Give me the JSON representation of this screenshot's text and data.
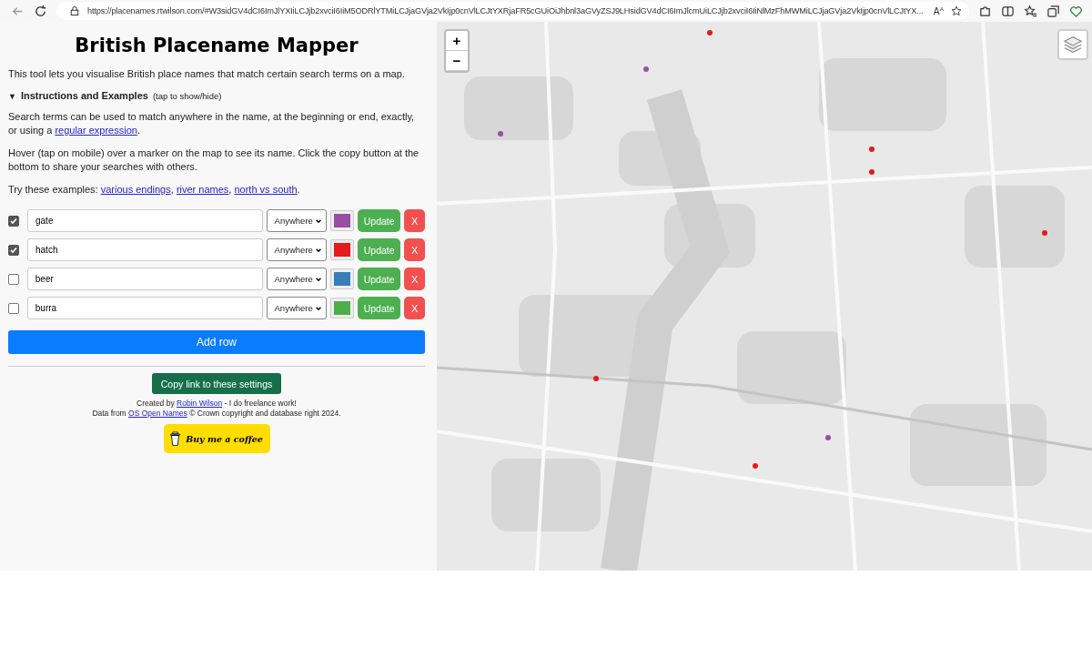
{
  "browser": {
    "url": "https://placenames.rtwilson.com/#W3sidGV4dCI6ImJlYXIiLCJjb2xvciI6IiM5ODRlYTMiLCJjaGVja2VkIjp0cnVlLCJtYXRjaFR5cGUiOiJhbnl3aGVyZSJ9LHsidGV4dCI6ImJlcmUiLCJjb2xvciI6IiNlMzFhMWMiLCJjaGVja2VkIjp0cnVlLCJtYX...",
    "reader_label": "Aᴬ"
  },
  "title": "British Placename Mapper",
  "intro": "This tool lets you visualise British place names that match certain search terms on a map.",
  "instructions": {
    "expanded": true,
    "marker": "▼",
    "label": "Instructions and Examples",
    "hint": "(tap to show/hide)",
    "paragraphs": [
      [
        {
          "kind": "text",
          "text": "Search terms can be used to match anywhere in the name, at the beginning or end, exactly, or using a "
        },
        {
          "kind": "link",
          "text": "regular expression"
        },
        {
          "kind": "text",
          "text": "."
        }
      ],
      [
        {
          "kind": "text",
          "text": "Hover (tap on mobile) over a marker on the map to see its name. Click the copy button at the bottom to share your searches with others."
        }
      ],
      [
        {
          "kind": "text",
          "text": "Try these examples: "
        },
        {
          "kind": "link",
          "text": "various endings"
        },
        {
          "kind": "text",
          "text": ", "
        },
        {
          "kind": "link",
          "text": "river names"
        },
        {
          "kind": "text",
          "text": ", "
        },
        {
          "kind": "link",
          "text": "north vs south"
        },
        {
          "kind": "text",
          "text": "."
        }
      ]
    ]
  },
  "rows": [
    {
      "checked": true,
      "term": "gate",
      "mode": "Anywhere",
      "color": "#984ea3",
      "update": "Update",
      "remove": "X"
    },
    {
      "checked": true,
      "term": "hatch",
      "mode": "Anywhere",
      "color": "#e41a1c",
      "update": "Update",
      "remove": "X"
    },
    {
      "checked": false,
      "term": "beer",
      "mode": "Anywhere",
      "color": "#377eb8",
      "update": "Update",
      "remove": "X"
    },
    {
      "checked": false,
      "term": "burra",
      "mode": "Anywhere",
      "color": "#4daf4a",
      "update": "Update",
      "remove": "X"
    }
  ],
  "add_row": "Add row",
  "copy_link": "Copy link to these settings",
  "credits": [
    [
      {
        "kind": "text",
        "text": "Created by "
      },
      {
        "kind": "link",
        "text": "Robin Wilson"
      },
      {
        "kind": "text",
        "text": " - I do freelance work!"
      }
    ],
    [
      {
        "kind": "text",
        "text": "Data from "
      },
      {
        "kind": "link",
        "text": "OS Open Names"
      },
      {
        "kind": "text",
        "text": " © Crown copyright and database right 2024."
      }
    ]
  ],
  "coffee": "Buy me a coffee",
  "map": {
    "kind": "picture",
    "zoom_in": "+",
    "zoom_out": "−"
  }
}
